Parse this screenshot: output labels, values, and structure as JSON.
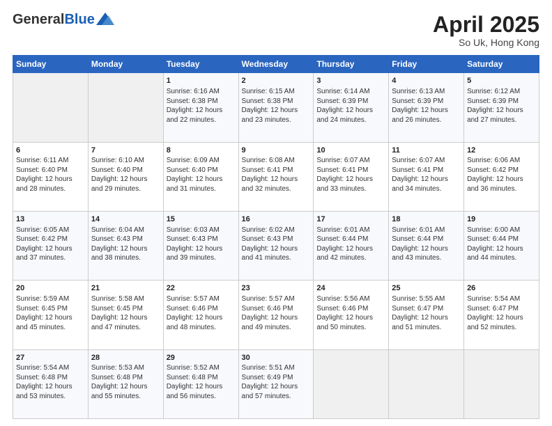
{
  "header": {
    "logo_general": "General",
    "logo_blue": "Blue",
    "title": "April 2025",
    "subtitle": "So Uk, Hong Kong"
  },
  "days_of_week": [
    "Sunday",
    "Monday",
    "Tuesday",
    "Wednesday",
    "Thursday",
    "Friday",
    "Saturday"
  ],
  "weeks": [
    [
      {
        "day": "",
        "info": ""
      },
      {
        "day": "",
        "info": ""
      },
      {
        "day": "1",
        "info": "Sunrise: 6:16 AM\nSunset: 6:38 PM\nDaylight: 12 hours and 22 minutes."
      },
      {
        "day": "2",
        "info": "Sunrise: 6:15 AM\nSunset: 6:38 PM\nDaylight: 12 hours and 23 minutes."
      },
      {
        "day": "3",
        "info": "Sunrise: 6:14 AM\nSunset: 6:39 PM\nDaylight: 12 hours and 24 minutes."
      },
      {
        "day": "4",
        "info": "Sunrise: 6:13 AM\nSunset: 6:39 PM\nDaylight: 12 hours and 26 minutes."
      },
      {
        "day": "5",
        "info": "Sunrise: 6:12 AM\nSunset: 6:39 PM\nDaylight: 12 hours and 27 minutes."
      }
    ],
    [
      {
        "day": "6",
        "info": "Sunrise: 6:11 AM\nSunset: 6:40 PM\nDaylight: 12 hours and 28 minutes."
      },
      {
        "day": "7",
        "info": "Sunrise: 6:10 AM\nSunset: 6:40 PM\nDaylight: 12 hours and 29 minutes."
      },
      {
        "day": "8",
        "info": "Sunrise: 6:09 AM\nSunset: 6:40 PM\nDaylight: 12 hours and 31 minutes."
      },
      {
        "day": "9",
        "info": "Sunrise: 6:08 AM\nSunset: 6:41 PM\nDaylight: 12 hours and 32 minutes."
      },
      {
        "day": "10",
        "info": "Sunrise: 6:07 AM\nSunset: 6:41 PM\nDaylight: 12 hours and 33 minutes."
      },
      {
        "day": "11",
        "info": "Sunrise: 6:07 AM\nSunset: 6:41 PM\nDaylight: 12 hours and 34 minutes."
      },
      {
        "day": "12",
        "info": "Sunrise: 6:06 AM\nSunset: 6:42 PM\nDaylight: 12 hours and 36 minutes."
      }
    ],
    [
      {
        "day": "13",
        "info": "Sunrise: 6:05 AM\nSunset: 6:42 PM\nDaylight: 12 hours and 37 minutes."
      },
      {
        "day": "14",
        "info": "Sunrise: 6:04 AM\nSunset: 6:43 PM\nDaylight: 12 hours and 38 minutes."
      },
      {
        "day": "15",
        "info": "Sunrise: 6:03 AM\nSunset: 6:43 PM\nDaylight: 12 hours and 39 minutes."
      },
      {
        "day": "16",
        "info": "Sunrise: 6:02 AM\nSunset: 6:43 PM\nDaylight: 12 hours and 41 minutes."
      },
      {
        "day": "17",
        "info": "Sunrise: 6:01 AM\nSunset: 6:44 PM\nDaylight: 12 hours and 42 minutes."
      },
      {
        "day": "18",
        "info": "Sunrise: 6:01 AM\nSunset: 6:44 PM\nDaylight: 12 hours and 43 minutes."
      },
      {
        "day": "19",
        "info": "Sunrise: 6:00 AM\nSunset: 6:44 PM\nDaylight: 12 hours and 44 minutes."
      }
    ],
    [
      {
        "day": "20",
        "info": "Sunrise: 5:59 AM\nSunset: 6:45 PM\nDaylight: 12 hours and 45 minutes."
      },
      {
        "day": "21",
        "info": "Sunrise: 5:58 AM\nSunset: 6:45 PM\nDaylight: 12 hours and 47 minutes."
      },
      {
        "day": "22",
        "info": "Sunrise: 5:57 AM\nSunset: 6:46 PM\nDaylight: 12 hours and 48 minutes."
      },
      {
        "day": "23",
        "info": "Sunrise: 5:57 AM\nSunset: 6:46 PM\nDaylight: 12 hours and 49 minutes."
      },
      {
        "day": "24",
        "info": "Sunrise: 5:56 AM\nSunset: 6:46 PM\nDaylight: 12 hours and 50 minutes."
      },
      {
        "day": "25",
        "info": "Sunrise: 5:55 AM\nSunset: 6:47 PM\nDaylight: 12 hours and 51 minutes."
      },
      {
        "day": "26",
        "info": "Sunrise: 5:54 AM\nSunset: 6:47 PM\nDaylight: 12 hours and 52 minutes."
      }
    ],
    [
      {
        "day": "27",
        "info": "Sunrise: 5:54 AM\nSunset: 6:48 PM\nDaylight: 12 hours and 53 minutes."
      },
      {
        "day": "28",
        "info": "Sunrise: 5:53 AM\nSunset: 6:48 PM\nDaylight: 12 hours and 55 minutes."
      },
      {
        "day": "29",
        "info": "Sunrise: 5:52 AM\nSunset: 6:48 PM\nDaylight: 12 hours and 56 minutes."
      },
      {
        "day": "30",
        "info": "Sunrise: 5:51 AM\nSunset: 6:49 PM\nDaylight: 12 hours and 57 minutes."
      },
      {
        "day": "",
        "info": ""
      },
      {
        "day": "",
        "info": ""
      },
      {
        "day": "",
        "info": ""
      }
    ]
  ]
}
